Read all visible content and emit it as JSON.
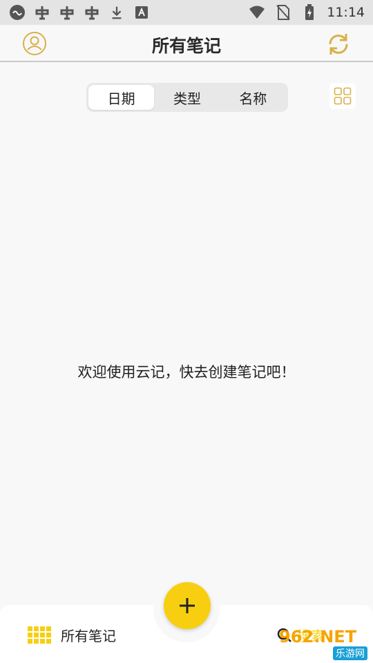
{
  "status_bar": {
    "time": "11:14",
    "icons": [
      "cast-icon",
      "bug-icon",
      "bug-icon",
      "bug-icon",
      "download-icon",
      "font-icon",
      "wifi-icon",
      "no-sim-icon",
      "battery-charging-icon"
    ]
  },
  "header": {
    "title": "所有笔记",
    "left_icon": "profile-icon",
    "right_icon": "sync-icon"
  },
  "sort_tabs": {
    "items": [
      {
        "label": "日期",
        "active": true
      },
      {
        "label": "类型",
        "active": false
      },
      {
        "label": "名称",
        "active": false
      }
    ]
  },
  "view_toggle": {
    "icon": "grid-view-icon"
  },
  "empty_state": {
    "message": "欢迎使用云记，快去创建笔记吧！"
  },
  "fab": {
    "icon": "plus-icon"
  },
  "bottom_nav": {
    "all_notes_label": "所有笔记",
    "search_label": "搜索"
  },
  "watermark": {
    "top": "962.NET",
    "bottom": "乐游网"
  },
  "colors": {
    "accent": "#f7cf10",
    "icon_gold": "#d8b048",
    "background": "#f8f8f8"
  }
}
